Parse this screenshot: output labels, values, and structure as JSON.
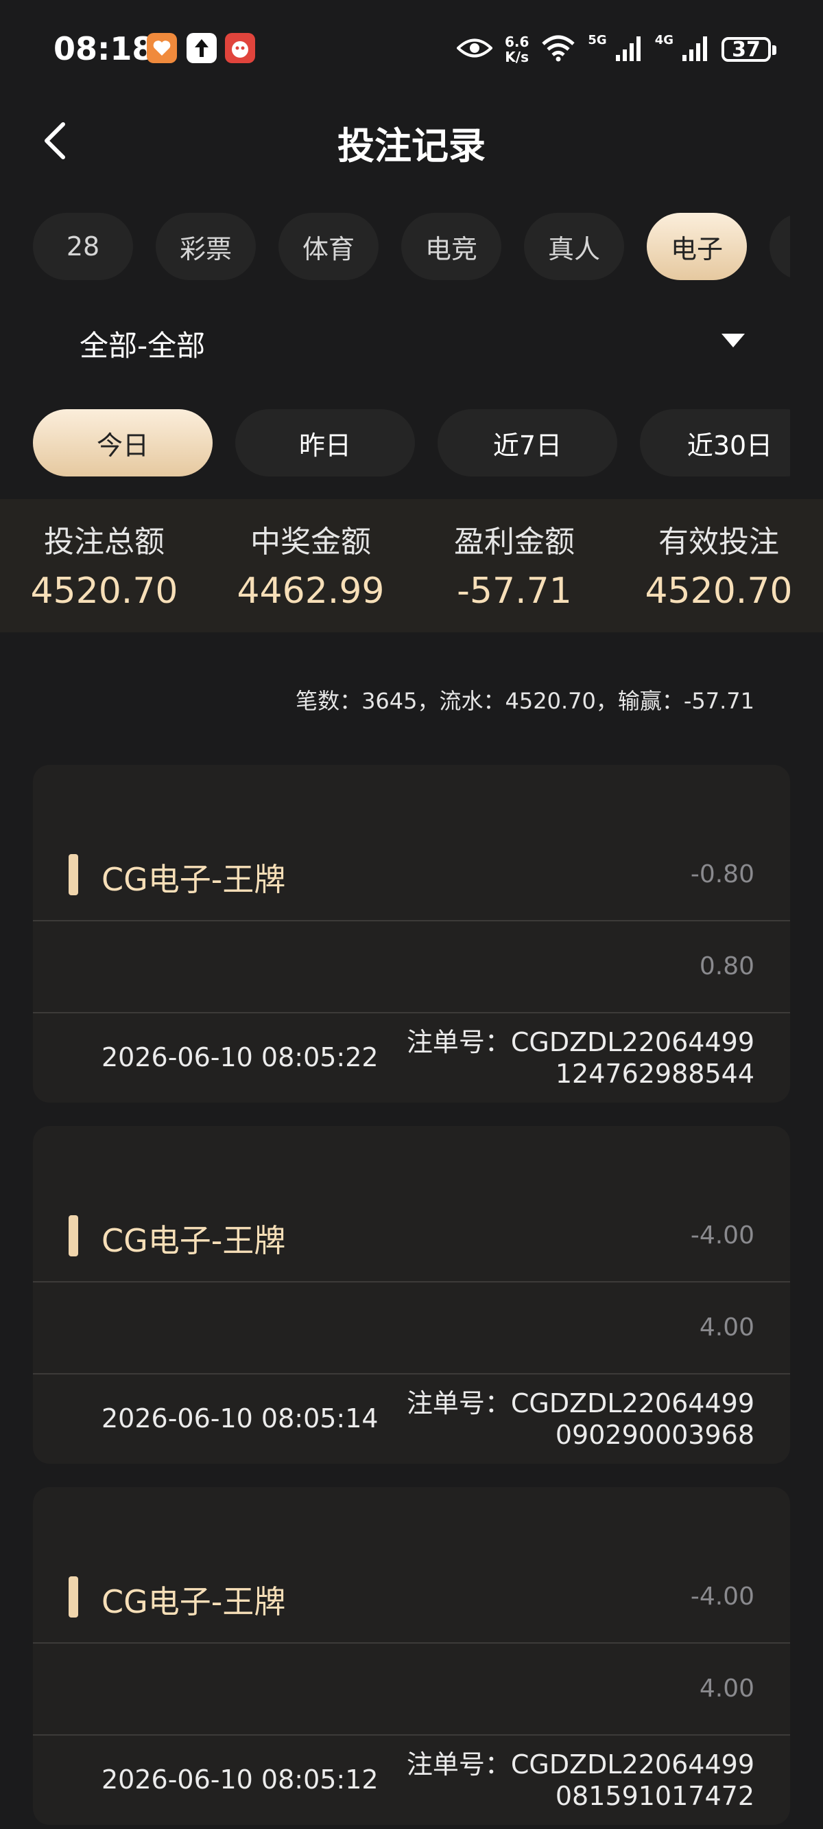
{
  "status_bar": {
    "time": "08:18",
    "speed_value": "6.6",
    "speed_unit": "K/s",
    "network_1": "5G",
    "network_2": "4G",
    "battery": "37"
  },
  "header": {
    "title": "投注记录"
  },
  "categories": {
    "tabs": [
      "28",
      "彩票",
      "体育",
      "电竞",
      "真人",
      "电子",
      ""
    ],
    "active_index": 5
  },
  "filter": {
    "label": "全部-全部"
  },
  "date_tabs": {
    "tabs": [
      "今日",
      "昨日",
      "近7日",
      "近30日"
    ],
    "active_index": 0
  },
  "summary": [
    {
      "label": "投注总额",
      "value": "4520.70"
    },
    {
      "label": "中奖金额",
      "value": "4462.99"
    },
    {
      "label": "盈利金额",
      "value": "-57.71"
    },
    {
      "label": "有效投注",
      "value": "4520.70"
    }
  ],
  "stats_line": "笔数：3645，流水：4520.70，输赢：-57.71",
  "records": [
    {
      "title": "CG电子-王牌",
      "profit": "-0.80",
      "bet": "0.80",
      "time": "2026-06-10 08:05:22",
      "order_line1": "注单号：CGDZDL22064499",
      "order_line2": "124762988544"
    },
    {
      "title": "CG电子-王牌",
      "profit": "-4.00",
      "bet": "4.00",
      "time": "2026-06-10 08:05:14",
      "order_line1": "注单号：CGDZDL22064499",
      "order_line2": "090290003968"
    },
    {
      "title": "CG电子-王牌",
      "profit": "-4.00",
      "bet": "4.00",
      "time": "2026-06-10 08:05:12",
      "order_line1": "注单号：CGDZDL22064499",
      "order_line2": "081591017472"
    }
  ],
  "colors": {
    "accent": "#f0d5ac",
    "accent_text": "#f7dfb8",
    "background": "#1b1b1c",
    "card": "#222120"
  },
  "icons": [
    "back-arrow-icon",
    "eye-icon",
    "wifi-icon",
    "signal-icon",
    "battery-icon",
    "dropdown-caret-icon"
  ]
}
